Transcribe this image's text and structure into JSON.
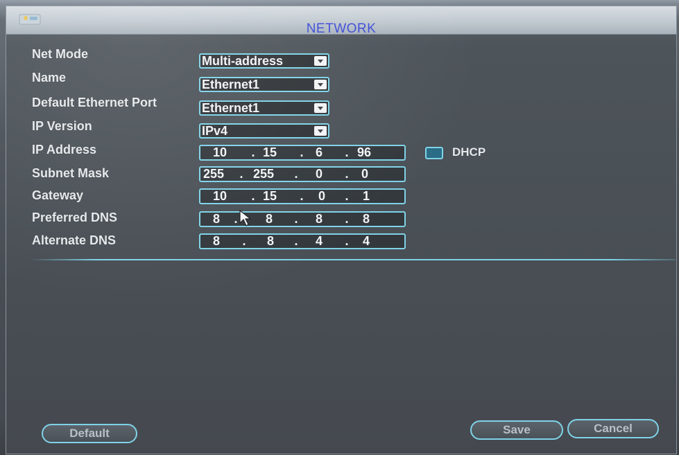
{
  "window": {
    "title": "NETWORK"
  },
  "fields": {
    "net_mode": {
      "label": "Net Mode",
      "value": "Multi-address"
    },
    "name": {
      "label": "Name",
      "value": "Ethernet1"
    },
    "default_port": {
      "label": "Default Ethernet Port",
      "value": "Ethernet1"
    },
    "ip_version": {
      "label": "IP Version",
      "value": "IPv4"
    },
    "ip_address": {
      "label": "IP Address",
      "octets": [
        "10",
        "15",
        "6",
        "96"
      ]
    },
    "subnet_mask": {
      "label": "Subnet Mask",
      "octets": [
        "255",
        "255",
        "0",
        "0"
      ]
    },
    "gateway": {
      "label": "Gateway",
      "octets": [
        "10",
        "15",
        "0",
        "1"
      ]
    },
    "preferred_dns": {
      "label": "Preferred DNS",
      "octets": [
        "8",
        "8",
        "8",
        "8"
      ]
    },
    "alternate_dns": {
      "label": "Alternate DNS",
      "octets": [
        "8",
        "8",
        "4",
        "4"
      ]
    }
  },
  "dhcp": {
    "label": "DHCP",
    "checked": false
  },
  "separator": ".",
  "buttons": {
    "default": "Default",
    "save": "Save",
    "cancel": "Cancel"
  },
  "colors": {
    "title_text": "#3d4bd8",
    "accent_border": "#7fd3e8",
    "label_text": "#e6e9ec"
  }
}
